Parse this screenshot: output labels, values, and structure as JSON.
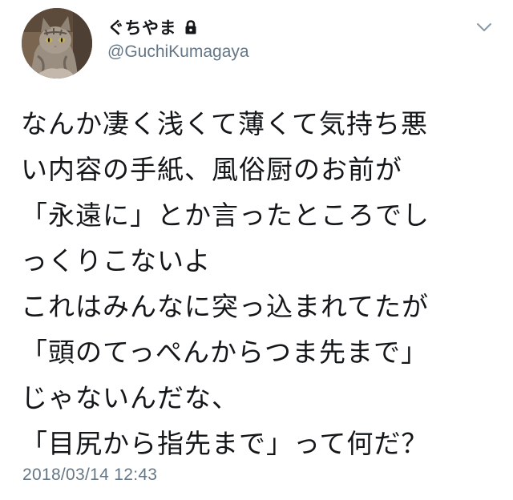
{
  "user": {
    "display_name": "ぐちやま",
    "handle": "@GuchiKumagaya",
    "avatar_icon": "cat-avatar",
    "protected_icon": "lock-icon"
  },
  "menu": {
    "icon": "chevron-down-icon"
  },
  "tweet": {
    "lines": [
      "なんか凄く浅くて薄くて気持ち悪",
      "い内容の手紙、風俗厨のお前が",
      "「永遠に」とか言ったところでし",
      "っくりこないよ",
      "これはみんなに突っ込まれてたが",
      "「頭のてっぺんからつま先まで」",
      "じゃないんだな、",
      "「目尻から指先まで」って何だ？"
    ],
    "timestamp": "2018/03/14 12:43"
  },
  "colors": {
    "text": "#14171a",
    "secondary": "#657786",
    "background": "#ffffff"
  }
}
